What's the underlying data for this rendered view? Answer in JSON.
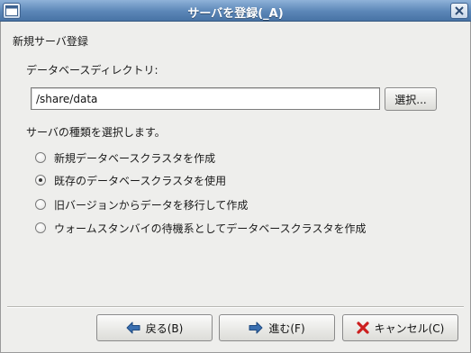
{
  "window": {
    "title": "サーバを登録(_A)"
  },
  "page": {
    "section_title": "新規サーバ登録",
    "directory_label": "データベースディレクトリ:",
    "directory_value": "/share/data",
    "browse_label": "選択...",
    "kind_label": "サーバの種類を選択します。",
    "options": [
      {
        "label": "新規データベースクラスタを作成",
        "selected": false
      },
      {
        "label": "既存のデータベースクラスタを使用",
        "selected": true
      },
      {
        "label": "旧バージョンからデータを移行して作成",
        "selected": false
      },
      {
        "label": "ウォームスタンバイの待機系としてデータベースクラスタを作成",
        "selected": false
      }
    ]
  },
  "buttons": {
    "back_label": "戻る(B)",
    "next_label": "進む(F)",
    "cancel_label": "キャンセル(C)"
  },
  "icons": {
    "back": "arrow-left-icon",
    "next": "arrow-right-icon",
    "cancel": "cancel-x-icon"
  },
  "colors": {
    "titlebar": "#5b86b7",
    "dialog_bg": "#eeeeec",
    "arrow_blue": "#3a6fb0",
    "cancel_red": "#cc1f1f"
  }
}
